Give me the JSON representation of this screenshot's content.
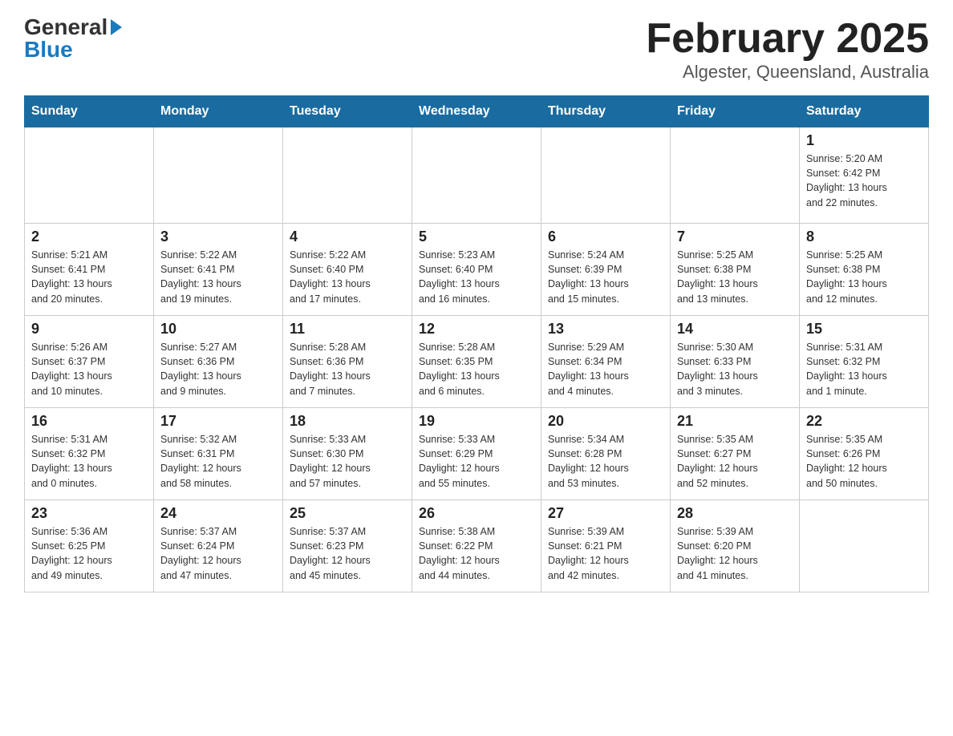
{
  "header": {
    "logo_general": "General",
    "logo_blue": "Blue",
    "title": "February 2025",
    "subtitle": "Algester, Queensland, Australia"
  },
  "days_of_week": [
    "Sunday",
    "Monday",
    "Tuesday",
    "Wednesday",
    "Thursday",
    "Friday",
    "Saturday"
  ],
  "weeks": [
    [
      {
        "day": "",
        "info": ""
      },
      {
        "day": "",
        "info": ""
      },
      {
        "day": "",
        "info": ""
      },
      {
        "day": "",
        "info": ""
      },
      {
        "day": "",
        "info": ""
      },
      {
        "day": "",
        "info": ""
      },
      {
        "day": "1",
        "info": "Sunrise: 5:20 AM\nSunset: 6:42 PM\nDaylight: 13 hours\nand 22 minutes."
      }
    ],
    [
      {
        "day": "2",
        "info": "Sunrise: 5:21 AM\nSunset: 6:41 PM\nDaylight: 13 hours\nand 20 minutes."
      },
      {
        "day": "3",
        "info": "Sunrise: 5:22 AM\nSunset: 6:41 PM\nDaylight: 13 hours\nand 19 minutes."
      },
      {
        "day": "4",
        "info": "Sunrise: 5:22 AM\nSunset: 6:40 PM\nDaylight: 13 hours\nand 17 minutes."
      },
      {
        "day": "5",
        "info": "Sunrise: 5:23 AM\nSunset: 6:40 PM\nDaylight: 13 hours\nand 16 minutes."
      },
      {
        "day": "6",
        "info": "Sunrise: 5:24 AM\nSunset: 6:39 PM\nDaylight: 13 hours\nand 15 minutes."
      },
      {
        "day": "7",
        "info": "Sunrise: 5:25 AM\nSunset: 6:38 PM\nDaylight: 13 hours\nand 13 minutes."
      },
      {
        "day": "8",
        "info": "Sunrise: 5:25 AM\nSunset: 6:38 PM\nDaylight: 13 hours\nand 12 minutes."
      }
    ],
    [
      {
        "day": "9",
        "info": "Sunrise: 5:26 AM\nSunset: 6:37 PM\nDaylight: 13 hours\nand 10 minutes."
      },
      {
        "day": "10",
        "info": "Sunrise: 5:27 AM\nSunset: 6:36 PM\nDaylight: 13 hours\nand 9 minutes."
      },
      {
        "day": "11",
        "info": "Sunrise: 5:28 AM\nSunset: 6:36 PM\nDaylight: 13 hours\nand 7 minutes."
      },
      {
        "day": "12",
        "info": "Sunrise: 5:28 AM\nSunset: 6:35 PM\nDaylight: 13 hours\nand 6 minutes."
      },
      {
        "day": "13",
        "info": "Sunrise: 5:29 AM\nSunset: 6:34 PM\nDaylight: 13 hours\nand 4 minutes."
      },
      {
        "day": "14",
        "info": "Sunrise: 5:30 AM\nSunset: 6:33 PM\nDaylight: 13 hours\nand 3 minutes."
      },
      {
        "day": "15",
        "info": "Sunrise: 5:31 AM\nSunset: 6:32 PM\nDaylight: 13 hours\nand 1 minute."
      }
    ],
    [
      {
        "day": "16",
        "info": "Sunrise: 5:31 AM\nSunset: 6:32 PM\nDaylight: 13 hours\nand 0 minutes."
      },
      {
        "day": "17",
        "info": "Sunrise: 5:32 AM\nSunset: 6:31 PM\nDaylight: 12 hours\nand 58 minutes."
      },
      {
        "day": "18",
        "info": "Sunrise: 5:33 AM\nSunset: 6:30 PM\nDaylight: 12 hours\nand 57 minutes."
      },
      {
        "day": "19",
        "info": "Sunrise: 5:33 AM\nSunset: 6:29 PM\nDaylight: 12 hours\nand 55 minutes."
      },
      {
        "day": "20",
        "info": "Sunrise: 5:34 AM\nSunset: 6:28 PM\nDaylight: 12 hours\nand 53 minutes."
      },
      {
        "day": "21",
        "info": "Sunrise: 5:35 AM\nSunset: 6:27 PM\nDaylight: 12 hours\nand 52 minutes."
      },
      {
        "day": "22",
        "info": "Sunrise: 5:35 AM\nSunset: 6:26 PM\nDaylight: 12 hours\nand 50 minutes."
      }
    ],
    [
      {
        "day": "23",
        "info": "Sunrise: 5:36 AM\nSunset: 6:25 PM\nDaylight: 12 hours\nand 49 minutes."
      },
      {
        "day": "24",
        "info": "Sunrise: 5:37 AM\nSunset: 6:24 PM\nDaylight: 12 hours\nand 47 minutes."
      },
      {
        "day": "25",
        "info": "Sunrise: 5:37 AM\nSunset: 6:23 PM\nDaylight: 12 hours\nand 45 minutes."
      },
      {
        "day": "26",
        "info": "Sunrise: 5:38 AM\nSunset: 6:22 PM\nDaylight: 12 hours\nand 44 minutes."
      },
      {
        "day": "27",
        "info": "Sunrise: 5:39 AM\nSunset: 6:21 PM\nDaylight: 12 hours\nand 42 minutes."
      },
      {
        "day": "28",
        "info": "Sunrise: 5:39 AM\nSunset: 6:20 PM\nDaylight: 12 hours\nand 41 minutes."
      },
      {
        "day": "",
        "info": ""
      }
    ]
  ]
}
